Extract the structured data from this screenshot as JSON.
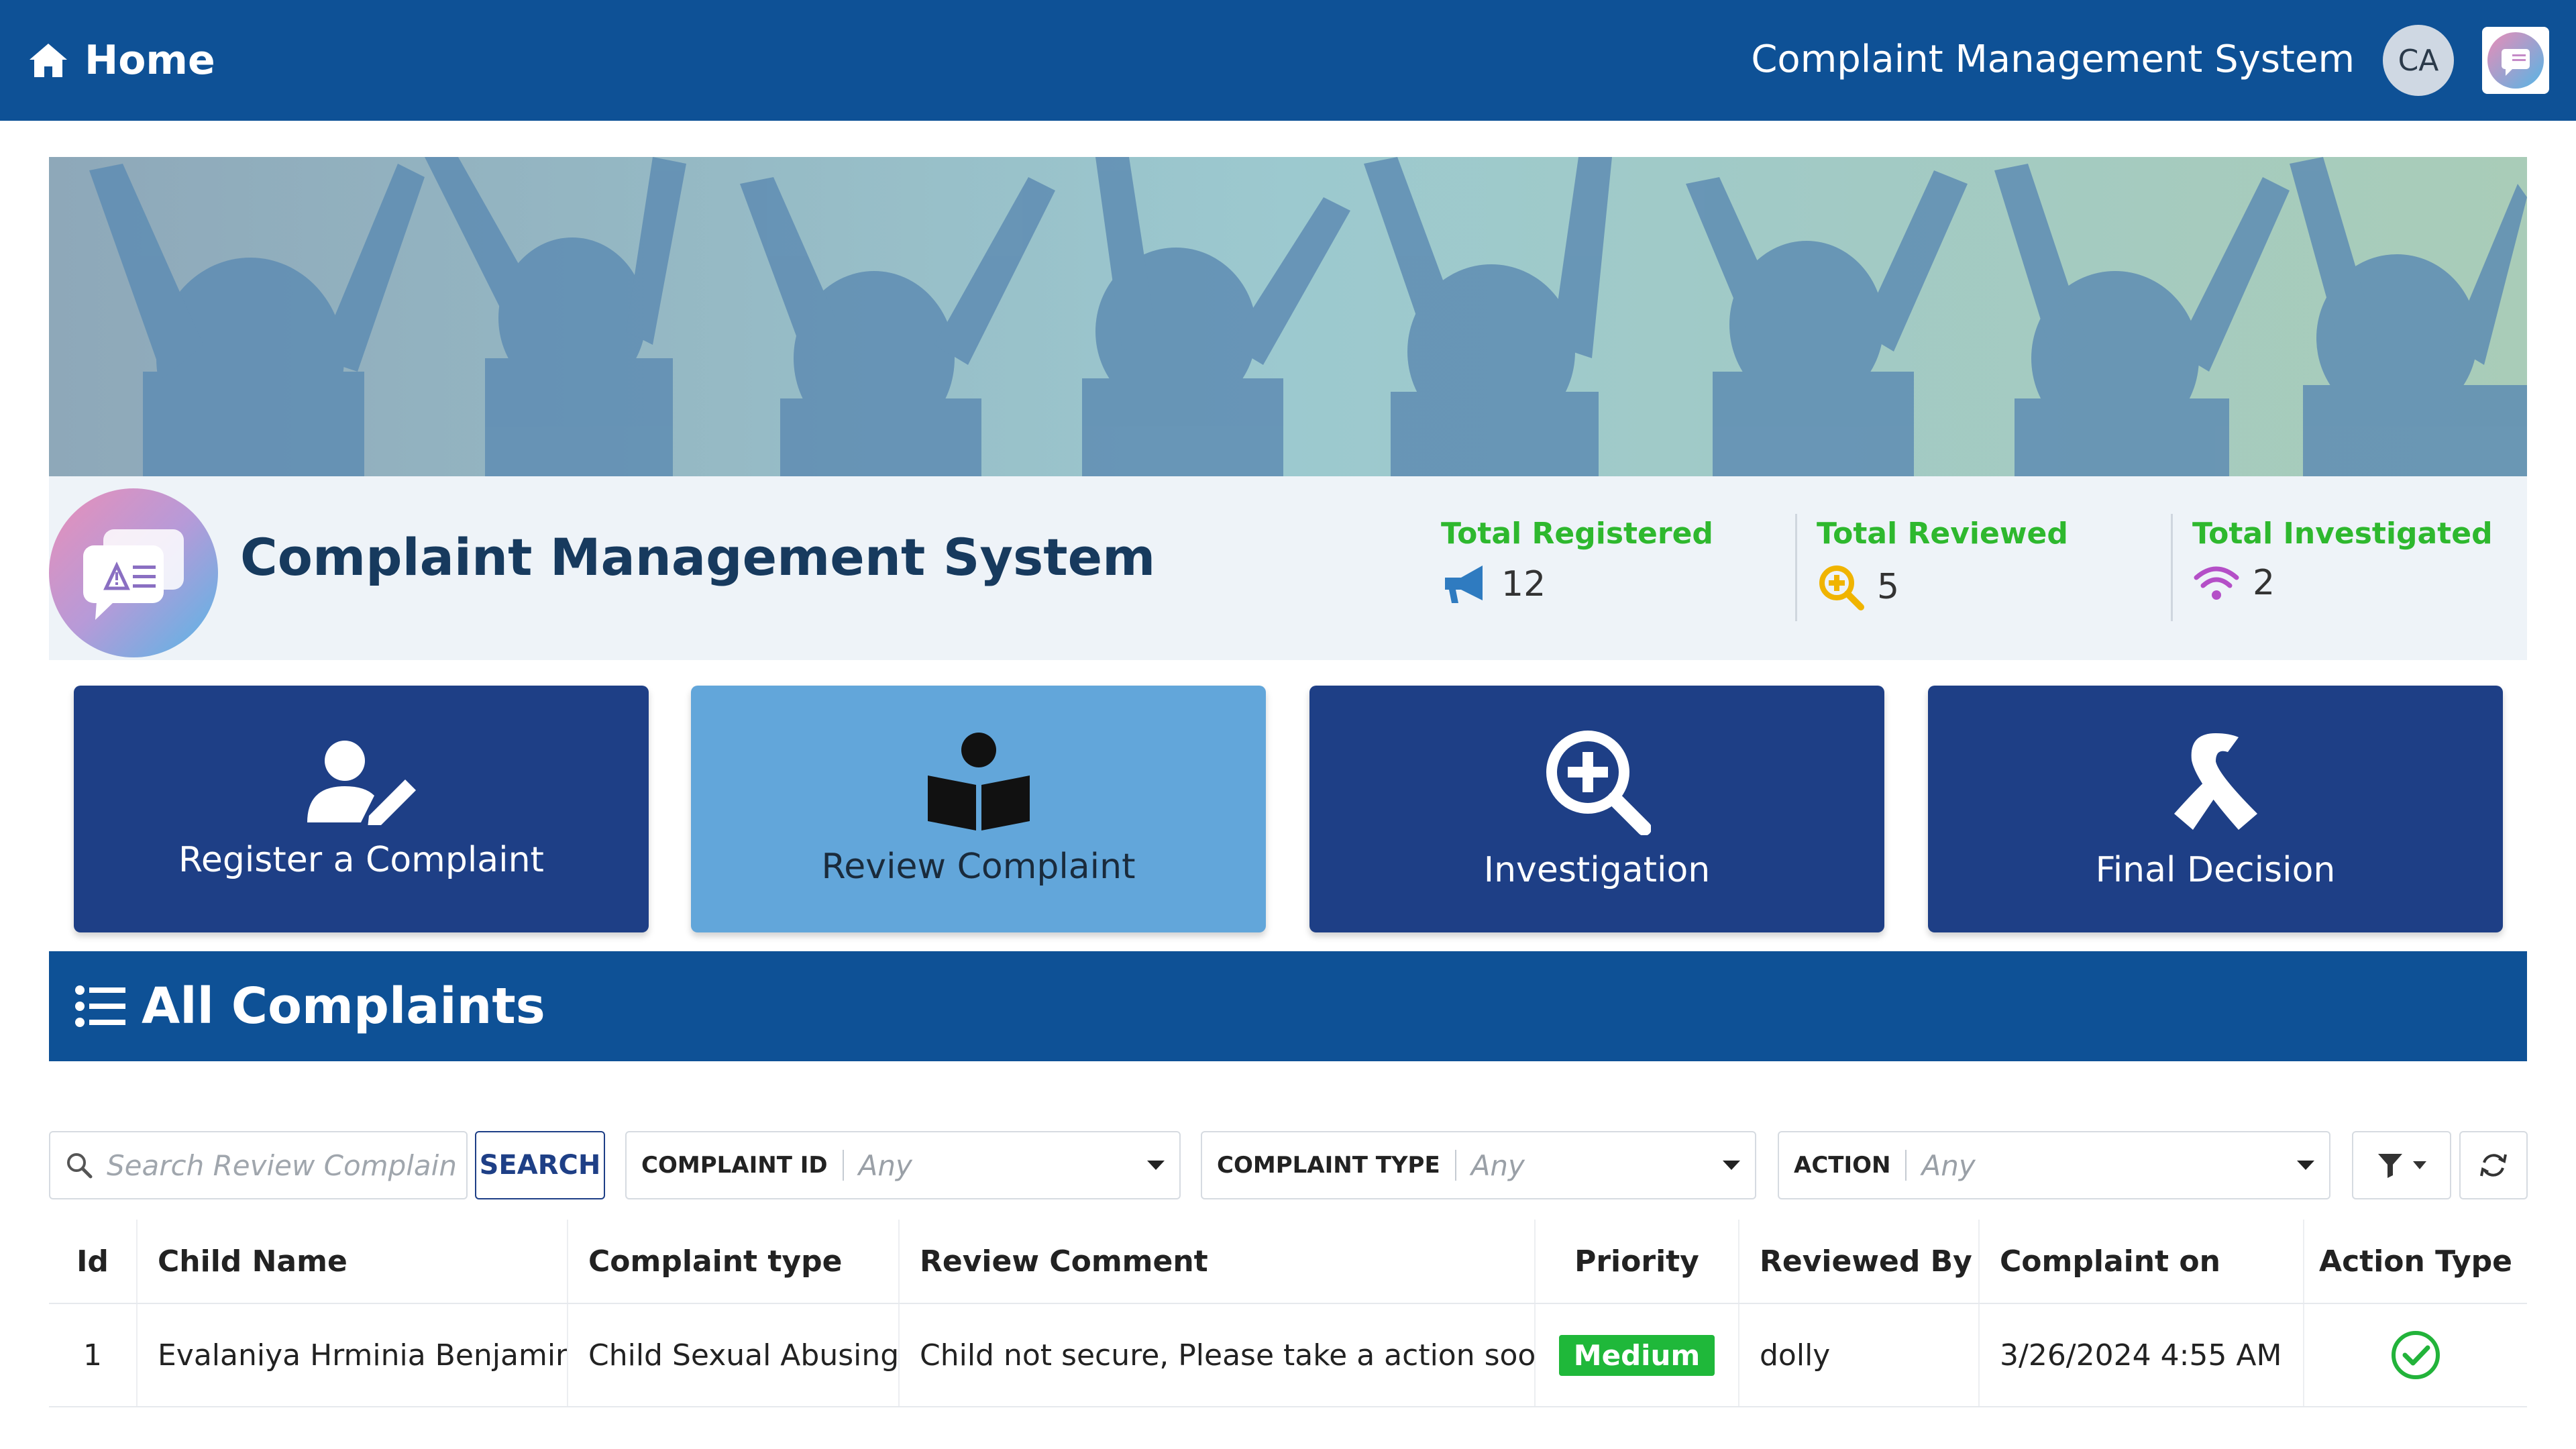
{
  "topbar": {
    "home_label": "Home",
    "title": "Complaint Management System",
    "avatar_initials": "CA",
    "icons": [
      "home-icon",
      "app-logo-icon"
    ]
  },
  "hero": {
    "title": "Complaint Management System",
    "stats": [
      {
        "label": "Total Registered",
        "value": "12",
        "icon": "megaphone-icon",
        "color": "#2eb82e"
      },
      {
        "label": "Total Reviewed",
        "value": "5",
        "icon": "search-plus-icon",
        "color": "#2eb82e"
      },
      {
        "label": "Total Investigated",
        "value": "2",
        "icon": "wifi-icon",
        "color": "#2eb82e"
      }
    ]
  },
  "cards": [
    {
      "label": "Register a Complaint",
      "icon": "user-edit-icon",
      "active": false
    },
    {
      "label": "Review Complaint",
      "icon": "book-reader-icon",
      "active": true
    },
    {
      "label": "Investigation",
      "icon": "search-plus-icon",
      "active": false
    },
    {
      "label": "Final Decision",
      "icon": "ribbon-icon",
      "active": false
    }
  ],
  "section": {
    "title": "All Complaints",
    "icon": "list-icon"
  },
  "filters": {
    "search_placeholder": "Search Review Complaints",
    "search_button": "SEARCH",
    "dropdowns": [
      {
        "label": "COMPLAINT ID",
        "value": "Any"
      },
      {
        "label": "COMPLAINT TYPE",
        "value": "Any"
      },
      {
        "label": "ACTION",
        "value": "Any"
      }
    ]
  },
  "table": {
    "columns": [
      "Id",
      "Child Name",
      "Complaint type",
      "Review Comment",
      "Priority",
      "Reviewed By",
      "Complaint on",
      "Action Type"
    ],
    "rows": [
      {
        "id": "1",
        "name": "Evalaniya Hrminia Benjamin",
        "type": "Child Sexual Abusing",
        "comment": "Child not secure, Please take a action soon",
        "priority": "Medium",
        "priority_color": "#1fb83a",
        "reviewed_by": "dolly",
        "complaint_on": "3/26/2024 4:55 AM",
        "action_icon": "check-circle-icon"
      }
    ]
  },
  "colors": {
    "primary": "#0e5196",
    "card": "#1e3f86",
    "card_active": "#62a6da",
    "stat_green": "#2eb82e"
  }
}
